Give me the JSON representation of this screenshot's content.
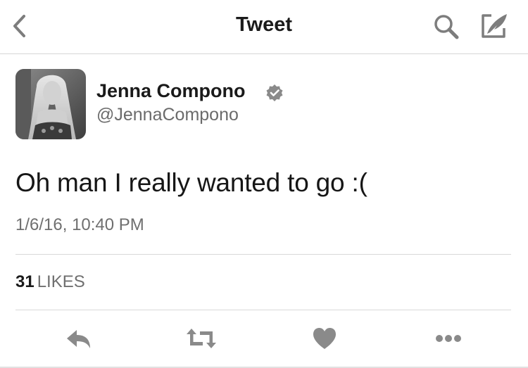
{
  "nav": {
    "title": "Tweet",
    "back_icon": "chevron-left-icon",
    "search_icon": "search-icon",
    "compose_icon": "compose-icon"
  },
  "tweet": {
    "author_name": "Jenna Compono",
    "author_handle": "@JennaCompono",
    "verified_icon": "verified-badge-icon",
    "text": "Oh man I really wanted to go :(",
    "timestamp": "1/6/16, 10:40 PM",
    "likes_count": "31",
    "likes_label": "LIKES"
  },
  "actions": [
    {
      "name": "reply",
      "icon": "reply-icon"
    },
    {
      "name": "retweet",
      "icon": "retweet-icon"
    },
    {
      "name": "like",
      "icon": "heart-icon"
    },
    {
      "name": "more",
      "icon": "more-icon"
    }
  ],
  "colors": {
    "text_primary": "#1a1a1a",
    "text_secondary": "#6f6f6f",
    "icon_gray": "#888888",
    "divider": "#d9d9d9",
    "background": "#ffffff"
  }
}
